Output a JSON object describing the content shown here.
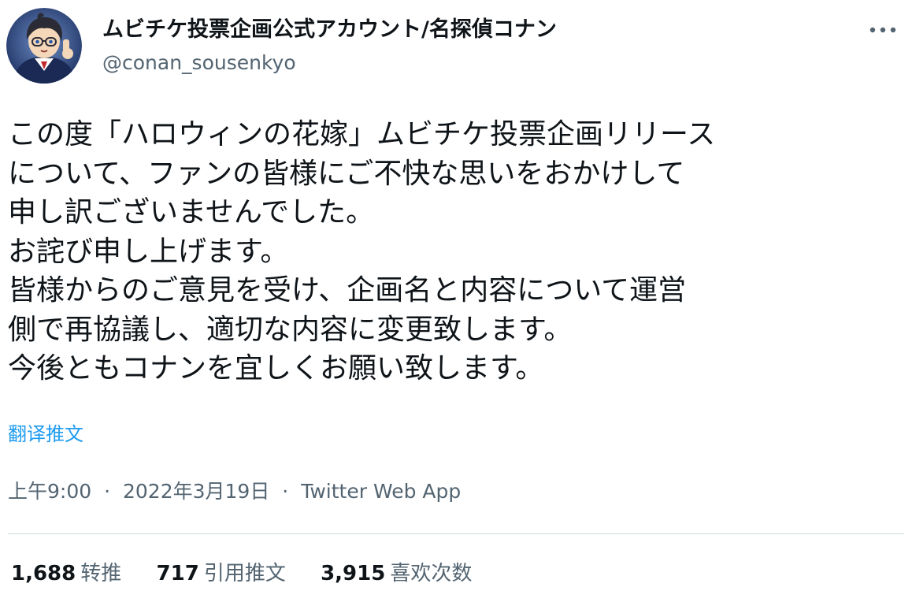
{
  "author": {
    "display_name": "ムビチケ投票企画公式アカウント/名探偵コナン",
    "handle": "@conan_sousenkyo",
    "avatar_icon": "detective-avatar-icon"
  },
  "menu_icon": "more-horizontal-icon",
  "tweet": {
    "lines": [
      "この度「ハロウィンの花嫁」ムビチケ投票企画リリース",
      "について、ファンの皆様にご不快な思いをおかけして",
      "申し訳ございませんでした。",
      "お詫び申し上げます。",
      "皆様からのご意見を受け、企画名と内容について運営",
      "側で再協議し、適切な内容に変更致します。",
      "今後ともコナンを宜しくお願い致します。"
    ],
    "translate_label": "翻译推文"
  },
  "meta": {
    "time": "上午9:00",
    "separator": "·",
    "date": "2022年3月19日",
    "source": "Twitter Web App"
  },
  "stats": {
    "retweets": {
      "count": "1,688",
      "label": "转推"
    },
    "quotes": {
      "count": "717",
      "label": "引用推文"
    },
    "likes": {
      "count": "3,915",
      "label": "喜欢次数"
    }
  },
  "colors": {
    "text": "#0f1419",
    "secondary": "#536471",
    "accent": "#1d9bf0",
    "divider": "#cfd9de"
  }
}
